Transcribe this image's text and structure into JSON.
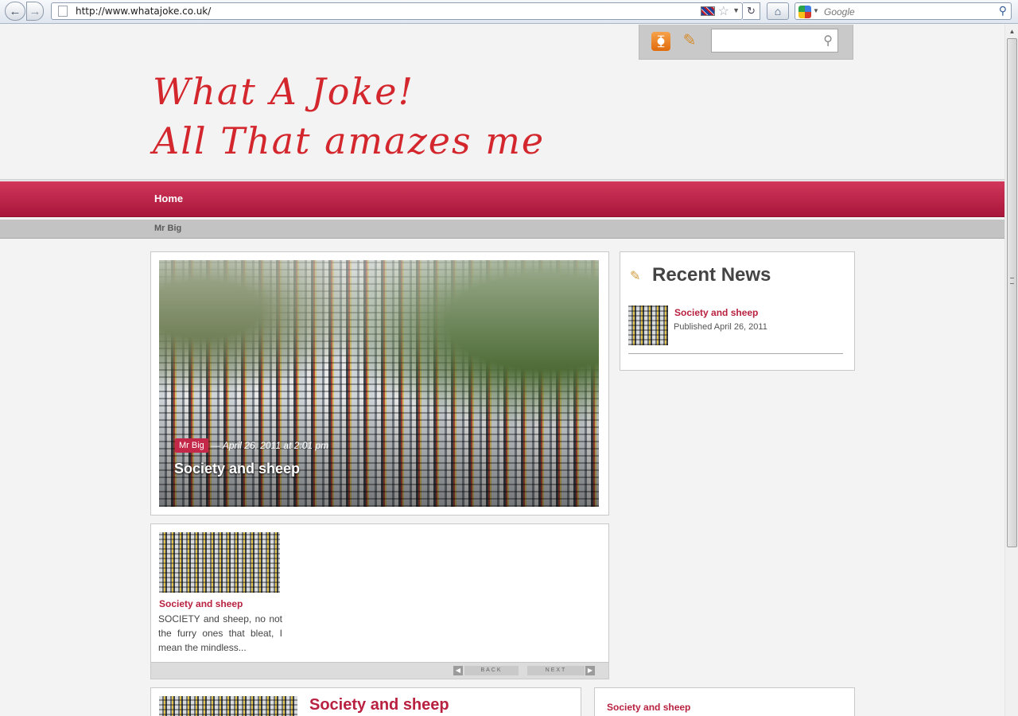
{
  "browser": {
    "url": "http://www.whatajoke.co.uk/",
    "search_placeholder": "Google",
    "icons": {
      "back": "back-arrow-icon",
      "forward": "forward-arrow-icon",
      "page": "page-icon",
      "flag": "uk-flag-icon",
      "star": "bookmark-star-icon",
      "reload": "reload-icon",
      "home": "home-icon",
      "google": "google-icon",
      "search": "search-icon"
    }
  },
  "toolbar": {
    "icons": [
      "rss-icon",
      "write-note-icon",
      "search-icon"
    ],
    "search_value": ""
  },
  "header": {
    "line1": "What A Joke!",
    "line2": "All That amazes me",
    "title_color": "#d3262d"
  },
  "nav": {
    "main": "Home",
    "sub": "Mr Big",
    "accent": "#b8213f"
  },
  "featured": {
    "tag": "Mr Big",
    "meta": "— April 26, 2011 at 2:01 pm",
    "title": "Society and sheep"
  },
  "slider": {
    "post_title": "Society and sheep",
    "excerpt": "SOCIETY and sheep, no not the furry ones that bleat, I mean the mindless...",
    "back_label": "BACK",
    "next_label": "NEXT"
  },
  "sidebar": {
    "title": "Recent News",
    "post_title": "Society and sheep",
    "post_meta": "Published April 26, 2011"
  },
  "bottom": {
    "title": "Society and sheep",
    "right_title": "Society and sheep"
  }
}
